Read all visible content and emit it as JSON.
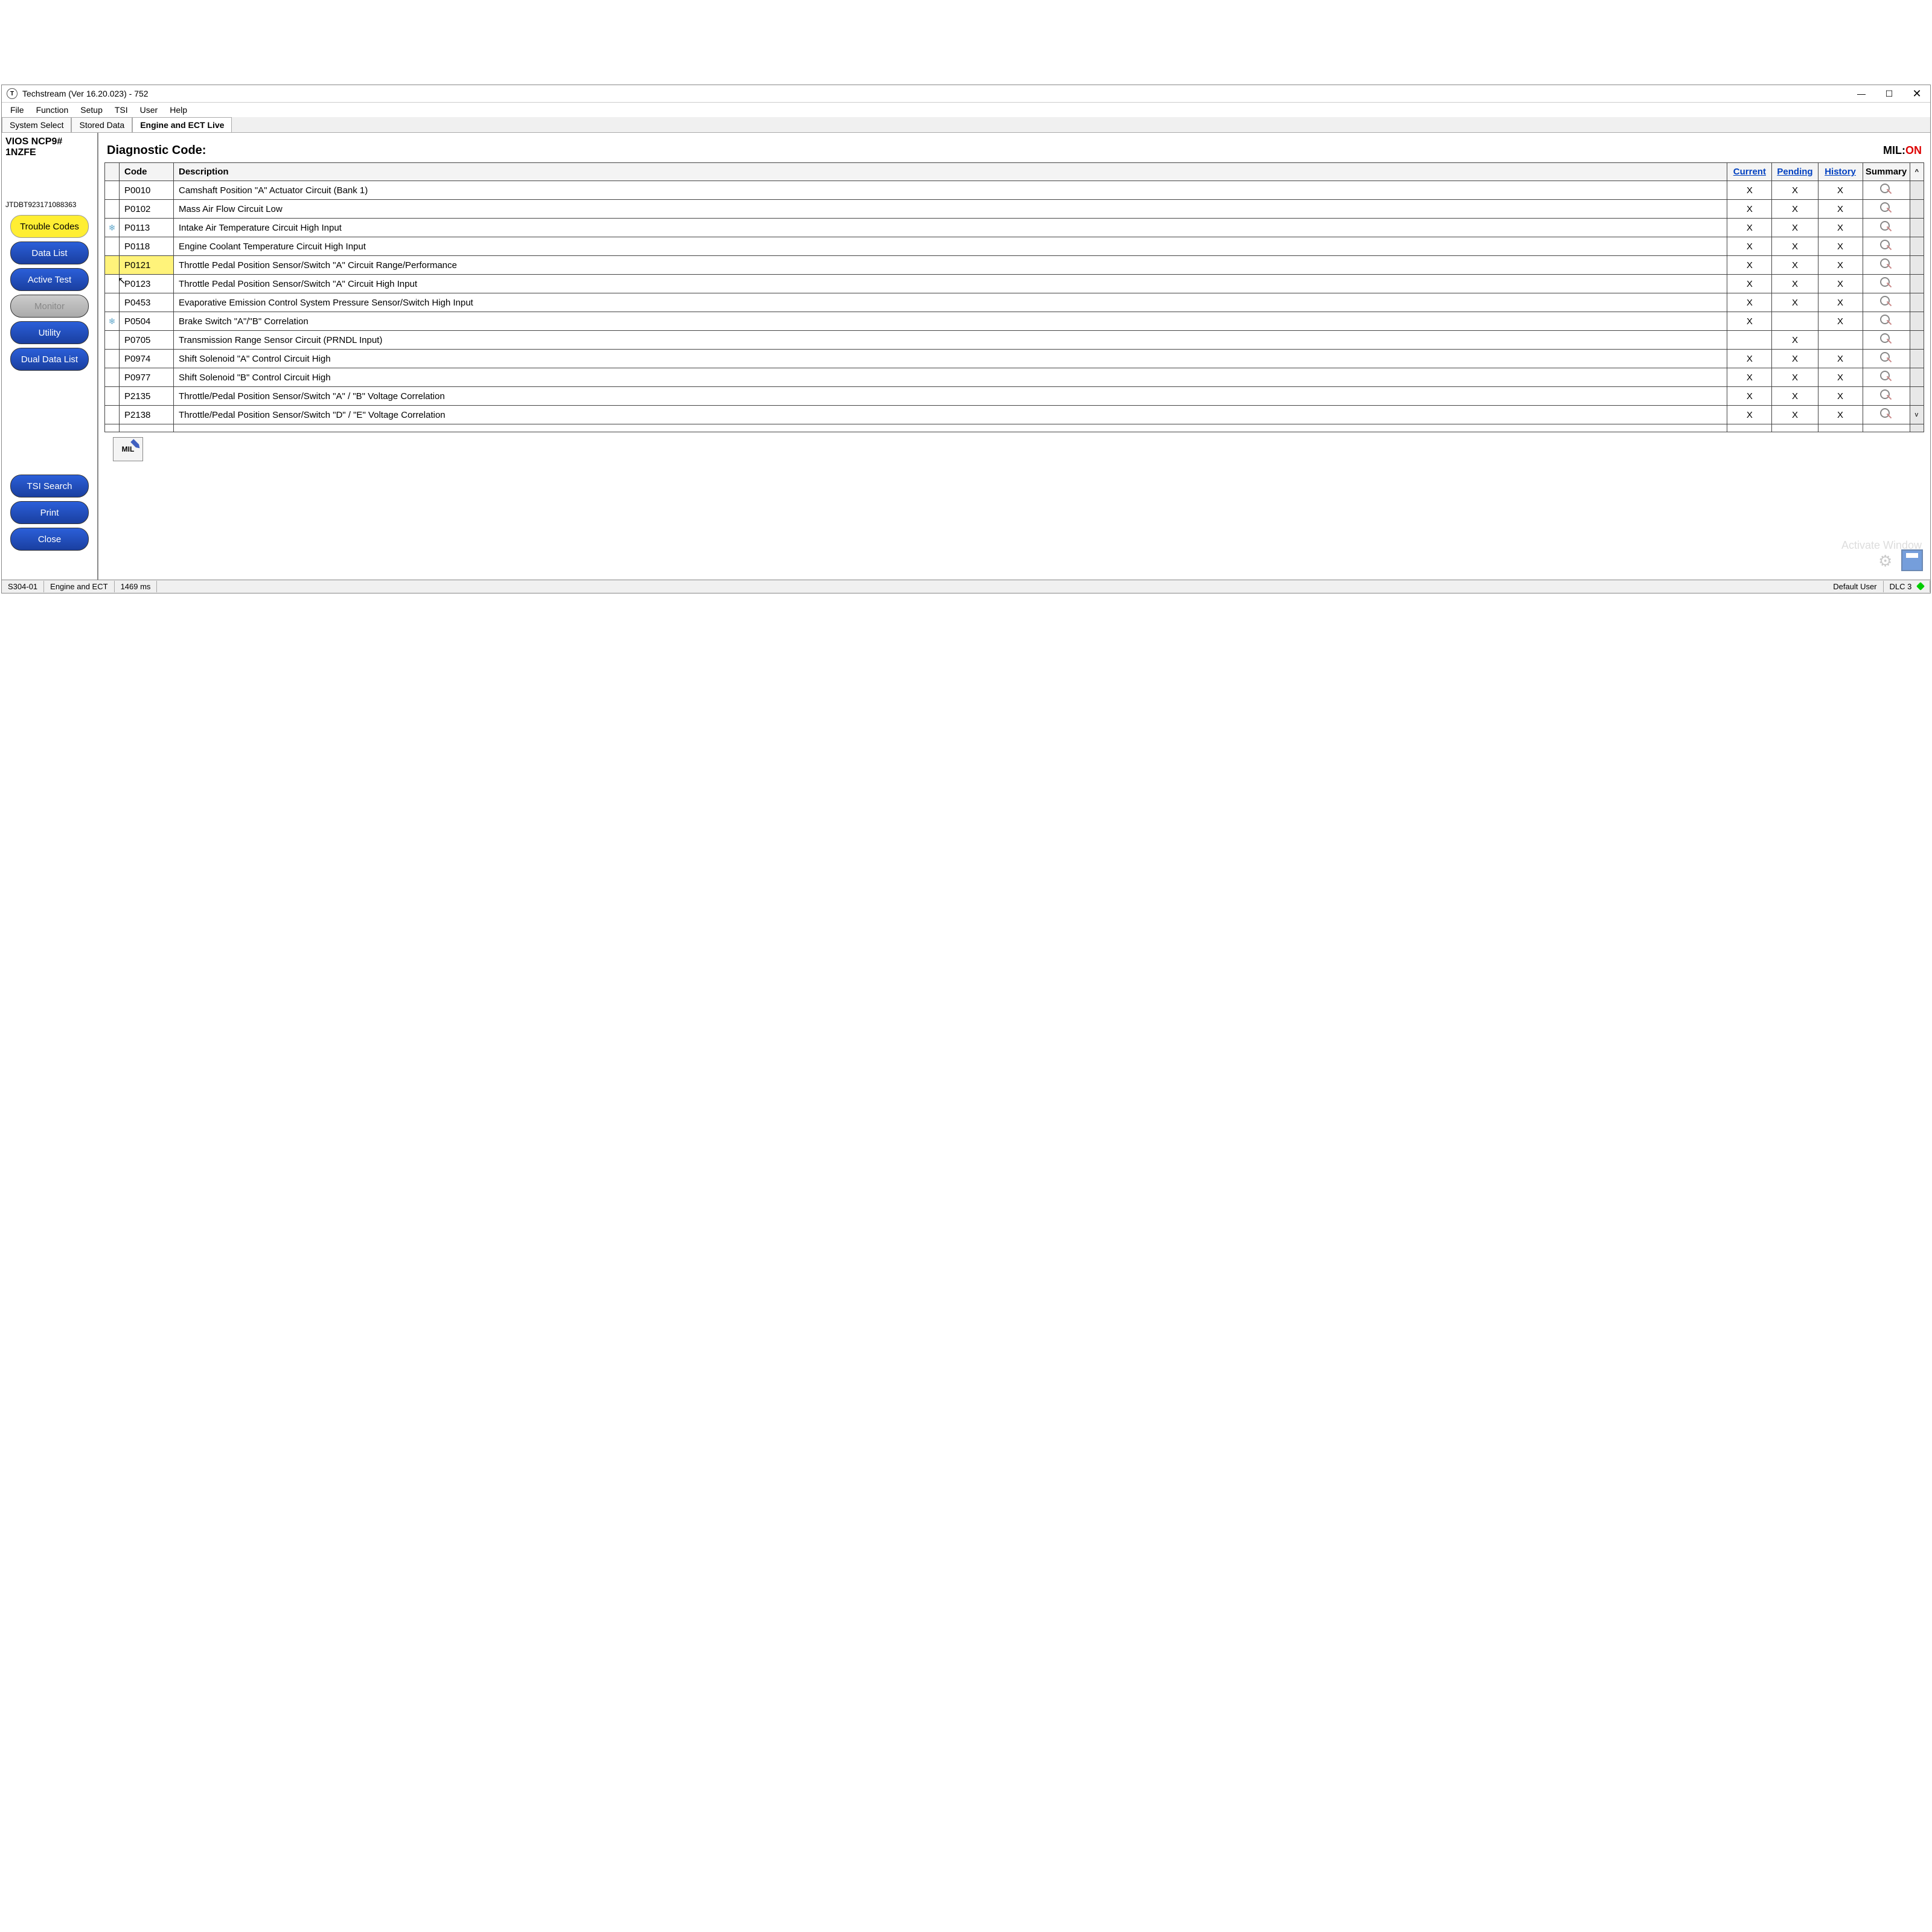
{
  "window": {
    "title": "Techstream (Ver 16.20.023) - 752",
    "app_icon_letter": "T"
  },
  "menu": [
    "File",
    "Function",
    "Setup",
    "TSI",
    "User",
    "Help"
  ],
  "tabs": [
    {
      "label": "System Select",
      "active": false
    },
    {
      "label": "Stored Data",
      "active": false
    },
    {
      "label": "Engine and ECT Live",
      "active": true
    }
  ],
  "vehicle": {
    "model": "VIOS NCP9#",
    "engine": "1NZFE",
    "vin": "JTDBT923171088363"
  },
  "nav": {
    "trouble_codes": "Trouble Codes",
    "data_list": "Data List",
    "active_test": "Active Test",
    "monitor": "Monitor",
    "utility": "Utility",
    "dual_data_list": "Dual Data List",
    "tsi_search": "TSI Search",
    "print": "Print",
    "close": "Close"
  },
  "diag": {
    "title": "Diagnostic Code:",
    "mil_label": "MIL:",
    "mil_status": "ON"
  },
  "columns": {
    "code": "Code",
    "desc": "Description",
    "current": "Current",
    "pending": "Pending",
    "history": "History",
    "summary": "Summary"
  },
  "rows": [
    {
      "flag": "",
      "code": "P0010",
      "desc": "Camshaft Position \"A\" Actuator Circuit (Bank 1)",
      "cur": "X",
      "pen": "X",
      "his": "X",
      "hl": false
    },
    {
      "flag": "",
      "code": "P0102",
      "desc": "Mass Air Flow Circuit Low",
      "cur": "X",
      "pen": "X",
      "his": "X",
      "hl": false
    },
    {
      "flag": "❄",
      "code": "P0113",
      "desc": "Intake Air Temperature Circuit High Input",
      "cur": "X",
      "pen": "X",
      "his": "X",
      "hl": false
    },
    {
      "flag": "",
      "code": "P0118",
      "desc": "Engine Coolant Temperature Circuit High Input",
      "cur": "X",
      "pen": "X",
      "his": "X",
      "hl": false
    },
    {
      "flag": "",
      "code": "P0121",
      "desc": "Throttle Pedal Position Sensor/Switch \"A\" Circuit Range/Performance",
      "cur": "X",
      "pen": "X",
      "his": "X",
      "hl": true
    },
    {
      "flag": "",
      "code": "P0123",
      "desc": "Throttle Pedal Position Sensor/Switch \"A\" Circuit High Input",
      "cur": "X",
      "pen": "X",
      "his": "X",
      "hl": false
    },
    {
      "flag": "",
      "code": "P0453",
      "desc": "Evaporative Emission Control System Pressure Sensor/Switch High Input",
      "cur": "X",
      "pen": "X",
      "his": "X",
      "hl": false
    },
    {
      "flag": "❄",
      "code": "P0504",
      "desc": "Brake Switch \"A\"/\"B\" Correlation",
      "cur": "X",
      "pen": "",
      "his": "X",
      "hl": false
    },
    {
      "flag": "",
      "code": "P0705",
      "desc": "Transmission Range Sensor Circuit (PRNDL Input)",
      "cur": "",
      "pen": "X",
      "his": "",
      "hl": false
    },
    {
      "flag": "",
      "code": "P0974",
      "desc": "Shift Solenoid \"A\" Control Circuit High",
      "cur": "X",
      "pen": "X",
      "his": "X",
      "hl": false
    },
    {
      "flag": "",
      "code": "P0977",
      "desc": "Shift Solenoid \"B\" Control Circuit High",
      "cur": "X",
      "pen": "X",
      "his": "X",
      "hl": false
    },
    {
      "flag": "",
      "code": "P2135",
      "desc": "Throttle/Pedal Position Sensor/Switch \"A\" / \"B\" Voltage Correlation",
      "cur": "X",
      "pen": "X",
      "his": "X",
      "hl": false
    },
    {
      "flag": "",
      "code": "P2138",
      "desc": "Throttle/Pedal Position Sensor/Switch \"D\" / \"E\" Voltage Correlation",
      "cur": "X",
      "pen": "X",
      "his": "X",
      "hl": false
    }
  ],
  "mil_icon_text": "MIL",
  "status": {
    "left1": "S304-01",
    "left2": "Engine and ECT",
    "left3": "1469 ms",
    "user": "Default User",
    "dlc": "DLC 3"
  },
  "watermark": "Activate Window"
}
